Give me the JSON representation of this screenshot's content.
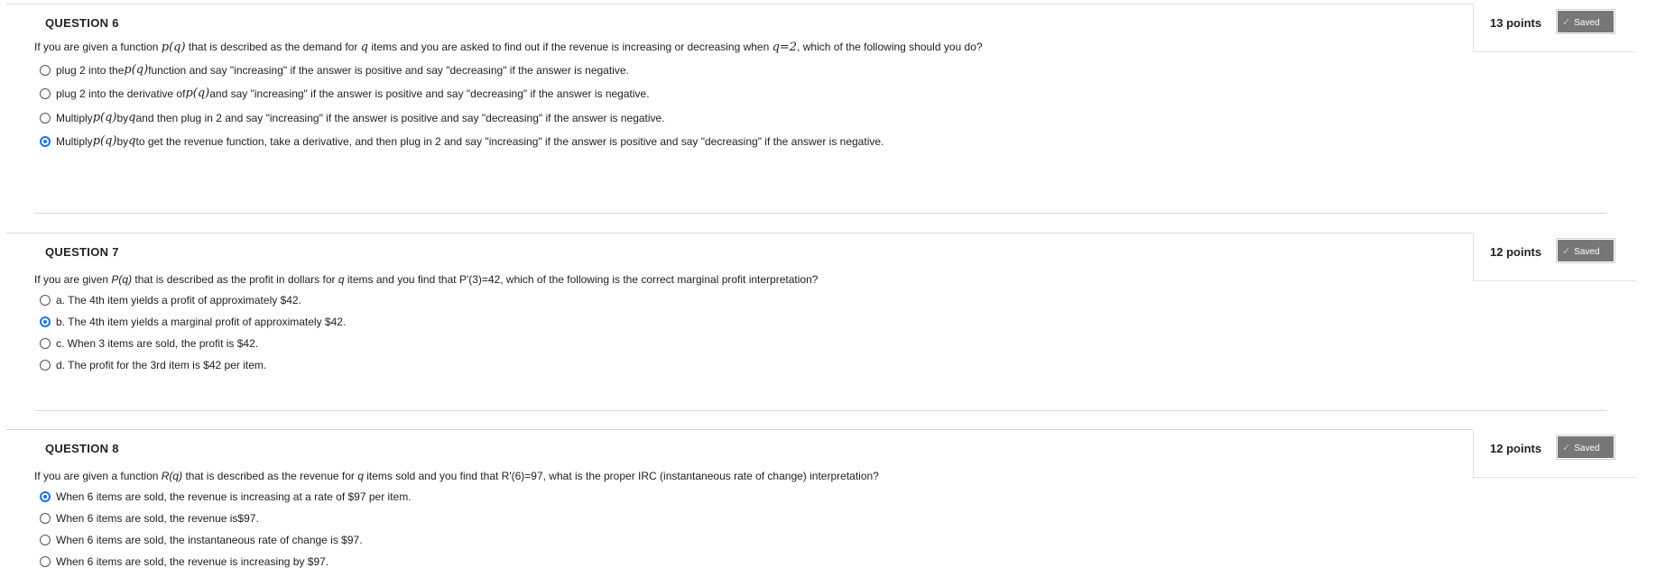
{
  "questions": [
    {
      "title": "QUESTION 6",
      "points": "13 points",
      "saved": "Saved",
      "text": {
        "a": "If you are given a function ",
        "b": "p(q)",
        "c": " that is described as the demand for ",
        "d": "q",
        "e": " items and you are asked to find out if the revenue is increasing or decreasing when ",
        "f": "q=2",
        "g": ", which of the following should you do?"
      },
      "options": [
        {
          "checked": false,
          "a": "plug 2 into the ",
          "b": "p(q)",
          "c": " function and say \"increasing\" if the answer is positive and say \"decreasing\" if the answer is negative."
        },
        {
          "checked": false,
          "a": "plug 2 into the derivative of ",
          "b": "p(q)",
          "c": " and say \"increasing\" if the answer is positive and say \"decreasing\" if the answer is negative."
        },
        {
          "checked": false,
          "a": "Multiply ",
          "b": "p(q)",
          "c": " by ",
          "d": "q",
          "e": " and then plug in 2 and say \"increasing\" if the answer is positive and say \"decreasing\" if the answer is negative."
        },
        {
          "checked": true,
          "a": "Multiply ",
          "b": "p(q)",
          "c": " by ",
          "d": "q",
          "e": " to get the revenue function, take a derivative, and then plug in 2 and say \"increasing\" if the answer is positive and say \"decreasing\" if the answer is negative."
        }
      ]
    },
    {
      "title": "QUESTION 7",
      "points": "12 points",
      "saved": "Saved",
      "text": {
        "a": "If you are given ",
        "b": "P(q)",
        "c": " that is described as the profit in dollars for ",
        "d": "q",
        "e": " items and you find that P'(3)=42, which of the following is the correct marginal profit interpretation?"
      },
      "options": [
        {
          "checked": false,
          "label": "a. The 4th item yields a profit of approximately $42."
        },
        {
          "checked": true,
          "label": "b. The 4th item yields a marginal profit of approximately $42."
        },
        {
          "checked": false,
          "label": "c. When 3 items are sold, the profit is $42."
        },
        {
          "checked": false,
          "label": "d. The profit for the 3rd item is $42 per item."
        }
      ]
    },
    {
      "title": "QUESTION 8",
      "points": "12 points",
      "saved": "Saved",
      "text": {
        "a": "If you are given a function ",
        "b": "R(q)",
        "c": " that is described as the revenue for ",
        "d": "q",
        "e": " items sold and you find that R'(6)=97, what is the proper IRC (instantaneous rate of change) interpretation?"
      },
      "options": [
        {
          "checked": true,
          "label": "When 6 items are sold, the revenue is increasing at a rate of $97 per item."
        },
        {
          "checked": false,
          "label": "When 6 items are sold, the revenue is$97."
        },
        {
          "checked": false,
          "label": "When 6 items are sold, the instantaneous rate of change is $97."
        },
        {
          "checked": false,
          "label": "When 6 items are sold, the revenue is increasing by $97."
        }
      ]
    }
  ],
  "colors": {
    "accent": "#1a73e8",
    "saved_bg": "#777777",
    "divider": "#d8d8d8"
  },
  "icons": {
    "saved": "check-icon"
  }
}
